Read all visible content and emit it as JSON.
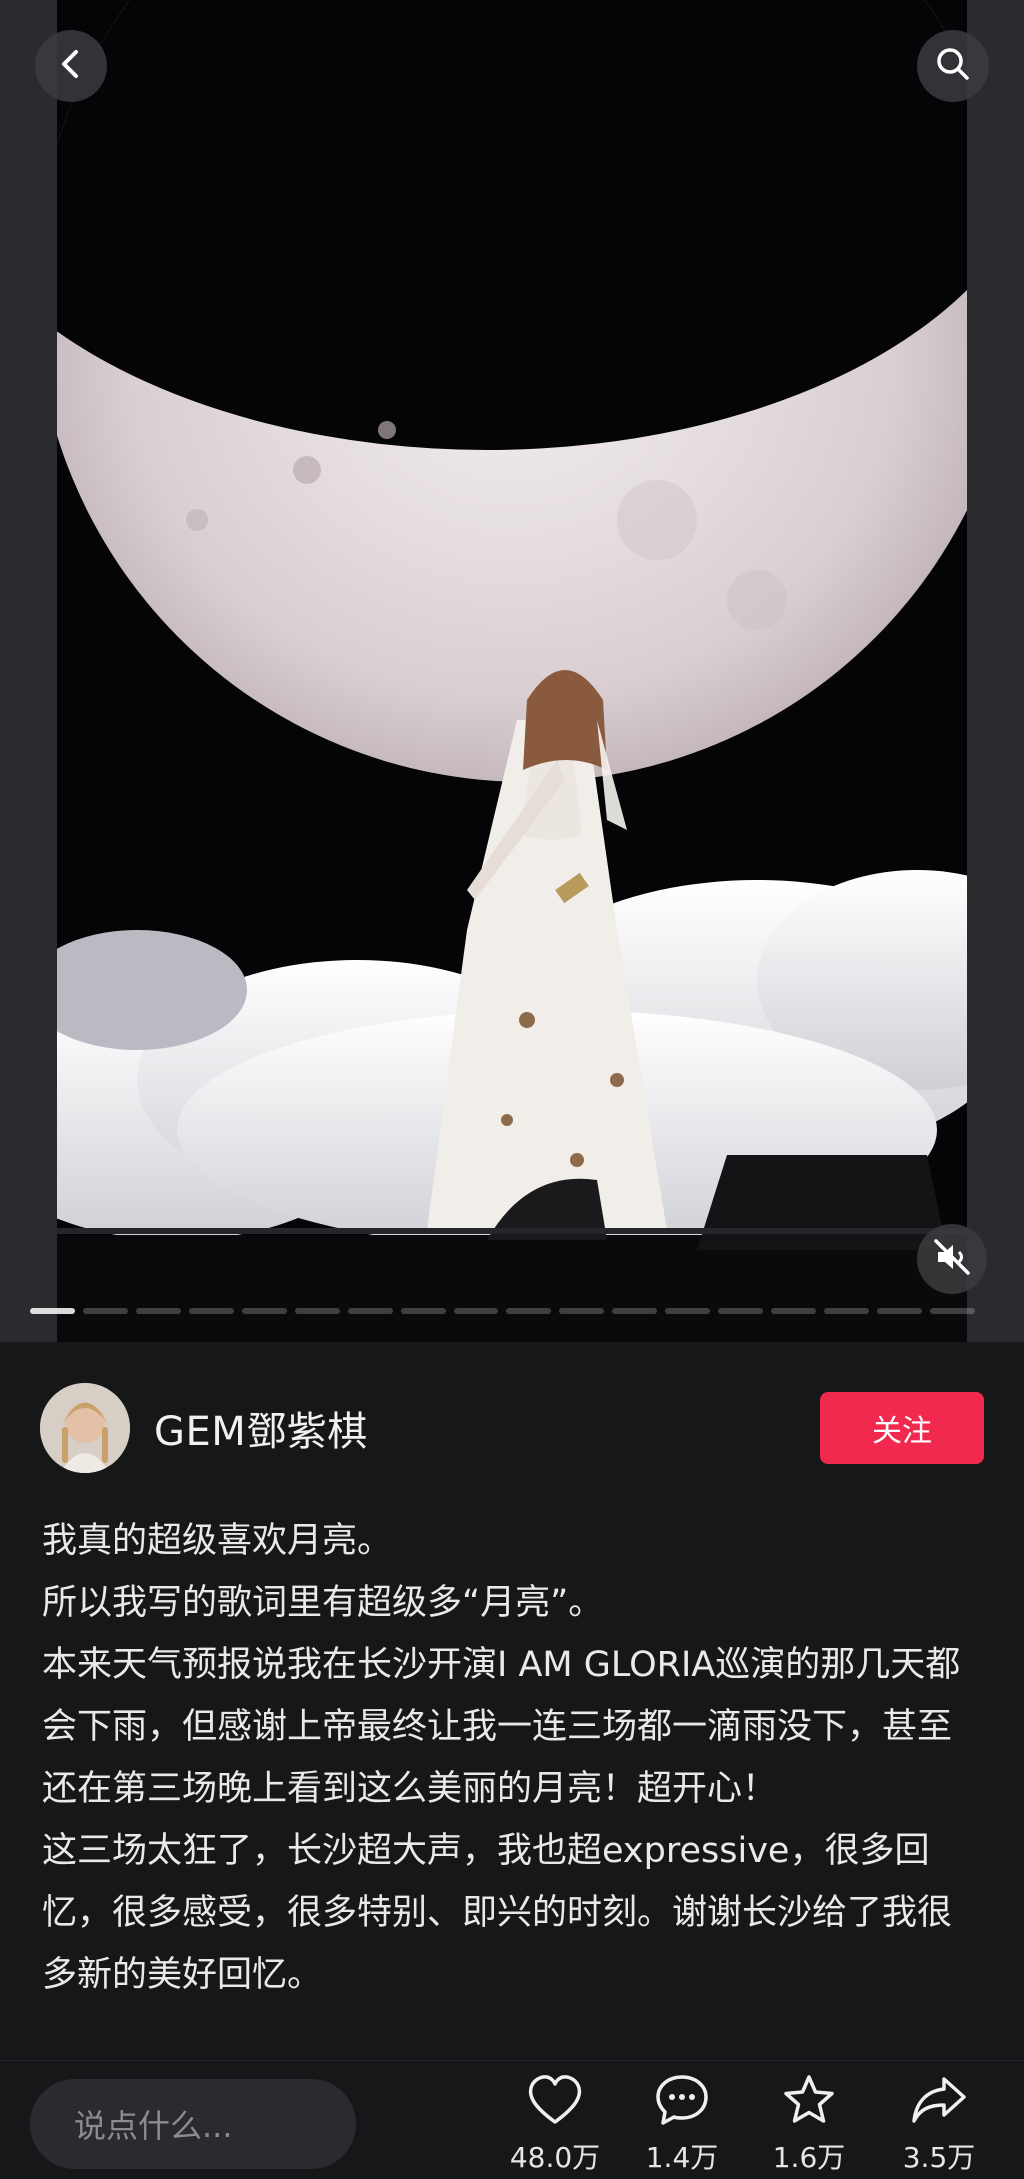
{
  "header": {
    "back_icon": "chevron-left-icon",
    "search_icon": "search-icon"
  },
  "media": {
    "mute_icon": "speaker-muted-icon",
    "slide_count": 18,
    "active_slide": 1
  },
  "author": {
    "name": "GEM鄧紫棋",
    "follow_label": "关注"
  },
  "caption": {
    "lines": [
      "我真的超级喜欢月亮。",
      "所以我写的歌词里有超级多“月亮”。",
      "本来天气预报说我在长沙开演I AM GLORIA巡演的那几天都会下雨，但感谢上帝最终让我一连三场都一滴雨没下，甚至还在第三场晚上看到这么美丽的月亮！超开心！",
      "这三场太狂了，长沙超大声，我也超expressive，很多回忆，很多感受，很多特别、即兴的时刻。谢谢长沙给了我很多新的美好回忆。"
    ]
  },
  "bottom_bar": {
    "comment_placeholder": "说点什么...",
    "like_count": "48.0万",
    "comment_count": "1.4万",
    "favorite_count": "1.6万",
    "share_count": "3.5万"
  },
  "colors": {
    "follow": "#f2294f",
    "background": "#161719"
  }
}
